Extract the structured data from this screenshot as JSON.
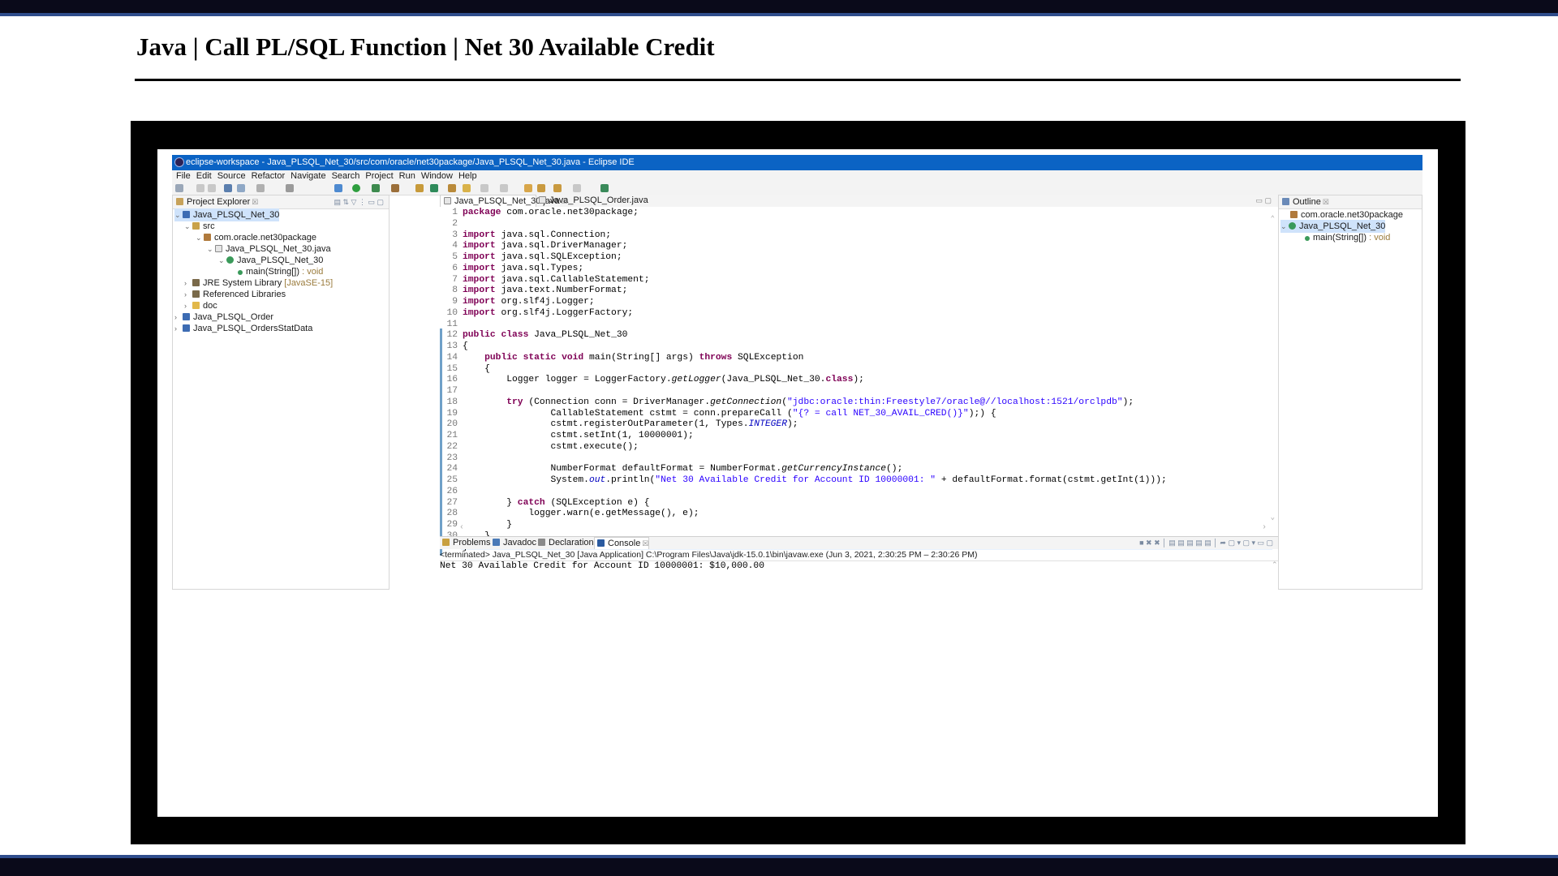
{
  "slide": {
    "title": "Java | Call PL/SQL Function | Net 30 Available Credit"
  },
  "ide": {
    "window_title": "eclipse-workspace - Java_PLSQL_Net_30/src/com/oracle/net30package/Java_PLSQL_Net_30.java - Eclipse IDE",
    "menu": [
      "File",
      "Edit",
      "Source",
      "Refactor",
      "Navigate",
      "Search",
      "Project",
      "Run",
      "Window",
      "Help"
    ]
  },
  "project_explorer": {
    "title": "Project Explorer",
    "items": [
      {
        "label": "Java_PLSQL_Net_30",
        "suffix": ""
      },
      {
        "label": "src",
        "suffix": ""
      },
      {
        "label": "com.oracle.net30package",
        "suffix": ""
      },
      {
        "label": "Java_PLSQL_Net_30.java",
        "suffix": ""
      },
      {
        "label": "Java_PLSQL_Net_30",
        "suffix": ""
      },
      {
        "label": "main(String[])",
        "suffix": " : void"
      },
      {
        "label": "JRE System Library",
        "suffix": " [JavaSE-15]"
      },
      {
        "label": "Referenced Libraries",
        "suffix": ""
      },
      {
        "label": "doc",
        "suffix": ""
      },
      {
        "label": "Java_PLSQL_Order",
        "suffix": ""
      },
      {
        "label": "Java_PLSQL_OrdersStatData",
        "suffix": ""
      }
    ]
  },
  "editor": {
    "tabs": [
      "Java_PLSQL_Net_30.java",
      "Java_PLSQL_Order.java"
    ],
    "active_tab": "Java_PLSQL_Net_30.java",
    "lines": [
      "package com.oracle.net30package;",
      "",
      "import java.sql.Connection;",
      "import java.sql.DriverManager;",
      "import java.sql.SQLException;",
      "import java.sql.Types;",
      "import java.sql.CallableStatement;",
      "import java.text.NumberFormat;",
      "import org.slf4j.Logger;",
      "import org.slf4j.LoggerFactory;",
      "",
      "public class Java_PLSQL_Net_30",
      "{",
      "    public static void main(String[] args) throws SQLException",
      "    {",
      "        Logger logger = LoggerFactory.getLogger(Java_PLSQL_Net_30.class);",
      "",
      "        try (Connection conn = DriverManager.getConnection(\"jdbc:oracle:thin:Freestyle7/oracle@//localhost:1521/orclpdb\");",
      "                CallableStatement cstmt = conn.prepareCall (\"{? = call NET_30_AVAIL_CRED()}\");) {",
      "                cstmt.registerOutParameter(1, Types.INTEGER);",
      "                cstmt.setInt(1, 10000001);",
      "                cstmt.execute();",
      "",
      "                NumberFormat defaultFormat = NumberFormat.getCurrencyInstance();",
      "                System.out.println(\"Net 30 Available Credit for Account ID 10000001: \" + defaultFormat.format(cstmt.getInt(1)));",
      "",
      "        } catch (SQLException e) {",
      "            logger.warn(e.getMessage(), e);",
      "        }",
      "    }",
      "}"
    ]
  },
  "outline": {
    "title": "Outline",
    "items": [
      {
        "label": "com.oracle.net30package",
        "suffix": ""
      },
      {
        "label": "Java_PLSQL_Net_30",
        "suffix": ""
      },
      {
        "label": "main(String[])",
        "suffix": " : void"
      }
    ]
  },
  "bottom_panel": {
    "tabs": [
      "Problems",
      "Javadoc",
      "Declaration",
      "Console"
    ],
    "active_tab": "Console",
    "status": "<terminated> Java_PLSQL_Net_30 [Java Application] C:\\Program Files\\Java\\jdk-15.0.1\\bin\\javaw.exe  (Jun 3, 2021, 2:30:25 PM – 2:30:26 PM)",
    "output": "Net 30 Available Credit for Account ID 10000001: $10,000.00"
  },
  "colors": {
    "title_bar": "#0b63c4",
    "slide_bars": "#0a0a1a",
    "slide_bar_border": "#2f4d8c",
    "keyword": "#7f0055",
    "string": "#2a00ff",
    "selection": "#cfe3fb"
  }
}
